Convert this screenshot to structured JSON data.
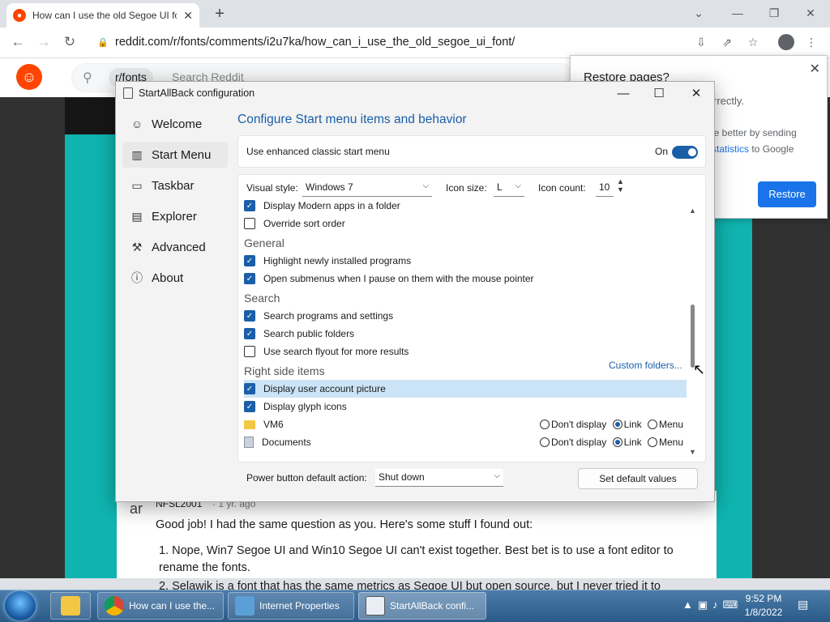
{
  "browser": {
    "tab_title": "How can I use the old Segoe UI font",
    "new_tab": "+",
    "url": "reddit.com/r/fonts/comments/i2u7ka/how_can_i_use_the_old_segoe_ui_font/"
  },
  "reddit": {
    "subreddit_chip": "r/fonts",
    "search_placeholder": "Search Reddit",
    "comment": {
      "author": "NFSL2001",
      "time": "· 1 yr. ago",
      "text": "Good job! I had the same question as you. Here's some stuff I found out:",
      "item1": "1. Nope, Win7 Segoe UI and Win10 Segoe UI can't exist together. Best bet is to use a font editor to rename the fonts.",
      "item2": "2. Selawik is a font that has the same metrics as Segoe UI but open source, but I never tried it to"
    }
  },
  "restore_popup": {
    "title": "Restore pages?",
    "message": "rrectly.",
    "message2": "ne better by sending",
    "message3_link": "statistics",
    "message3": " to Google",
    "button": "Restore"
  },
  "sab": {
    "title": "StartAllBack configuration",
    "nav": [
      {
        "label": "Welcome",
        "icon": "smile-icon"
      },
      {
        "label": "Start Menu",
        "icon": "start-menu-icon"
      },
      {
        "label": "Taskbar",
        "icon": "taskbar-icon"
      },
      {
        "label": "Explorer",
        "icon": "folder-icon"
      },
      {
        "label": "Advanced",
        "icon": "wrench-icon"
      },
      {
        "label": "About",
        "icon": "info-icon"
      }
    ],
    "heading": "Configure Start menu items and behavior",
    "enhanced": {
      "label": "Use enhanced classic start menu",
      "state": "On",
      "on": true
    },
    "visual_style": {
      "label": "Visual style:",
      "value": "Windows 7"
    },
    "icon_size": {
      "label": "Icon size:",
      "value": "L"
    },
    "icon_count": {
      "label": "Icon count:",
      "value": "10"
    },
    "items": [
      {
        "type": "check",
        "label": "Display Modern apps in a folder",
        "checked": true
      },
      {
        "type": "check",
        "label": "Override sort order",
        "checked": false
      },
      {
        "type": "section",
        "label": "General"
      },
      {
        "type": "check",
        "label": "Highlight newly installed programs",
        "checked": true
      },
      {
        "type": "check",
        "label": "Open submenus when I pause on them with the mouse pointer",
        "checked": true
      },
      {
        "type": "section",
        "label": "Search"
      },
      {
        "type": "check",
        "label": "Search programs and settings",
        "checked": true
      },
      {
        "type": "check",
        "label": "Search public folders",
        "checked": true
      },
      {
        "type": "check",
        "label": "Use search flyout for more results",
        "checked": false
      },
      {
        "type": "section",
        "label": "Right side items"
      },
      {
        "type": "check",
        "label": "Display user account picture",
        "checked": true,
        "highlight": true
      },
      {
        "type": "check",
        "label": "Display glyph icons",
        "checked": true
      }
    ],
    "custom_folders": "Custom folders...",
    "folders": [
      {
        "label": "VM6",
        "selected": "Link"
      },
      {
        "label": "Documents",
        "selected": "Link"
      }
    ],
    "radio_opts": [
      "Don't display",
      "Link",
      "Menu"
    ],
    "power": {
      "label": "Power button default action:",
      "value": "Shut down"
    },
    "set_default": "Set default values"
  },
  "taskbar": {
    "items": [
      {
        "label": "How can I use the...",
        "icon": "chrome-icon",
        "active": false
      },
      {
        "label": "Internet Properties",
        "icon": "internet-properties-icon",
        "active": false
      },
      {
        "label": "StartAllBack confi...",
        "icon": "startallback-icon",
        "active": true
      }
    ],
    "time": "9:52 PM",
    "date": "1/8/2022"
  }
}
